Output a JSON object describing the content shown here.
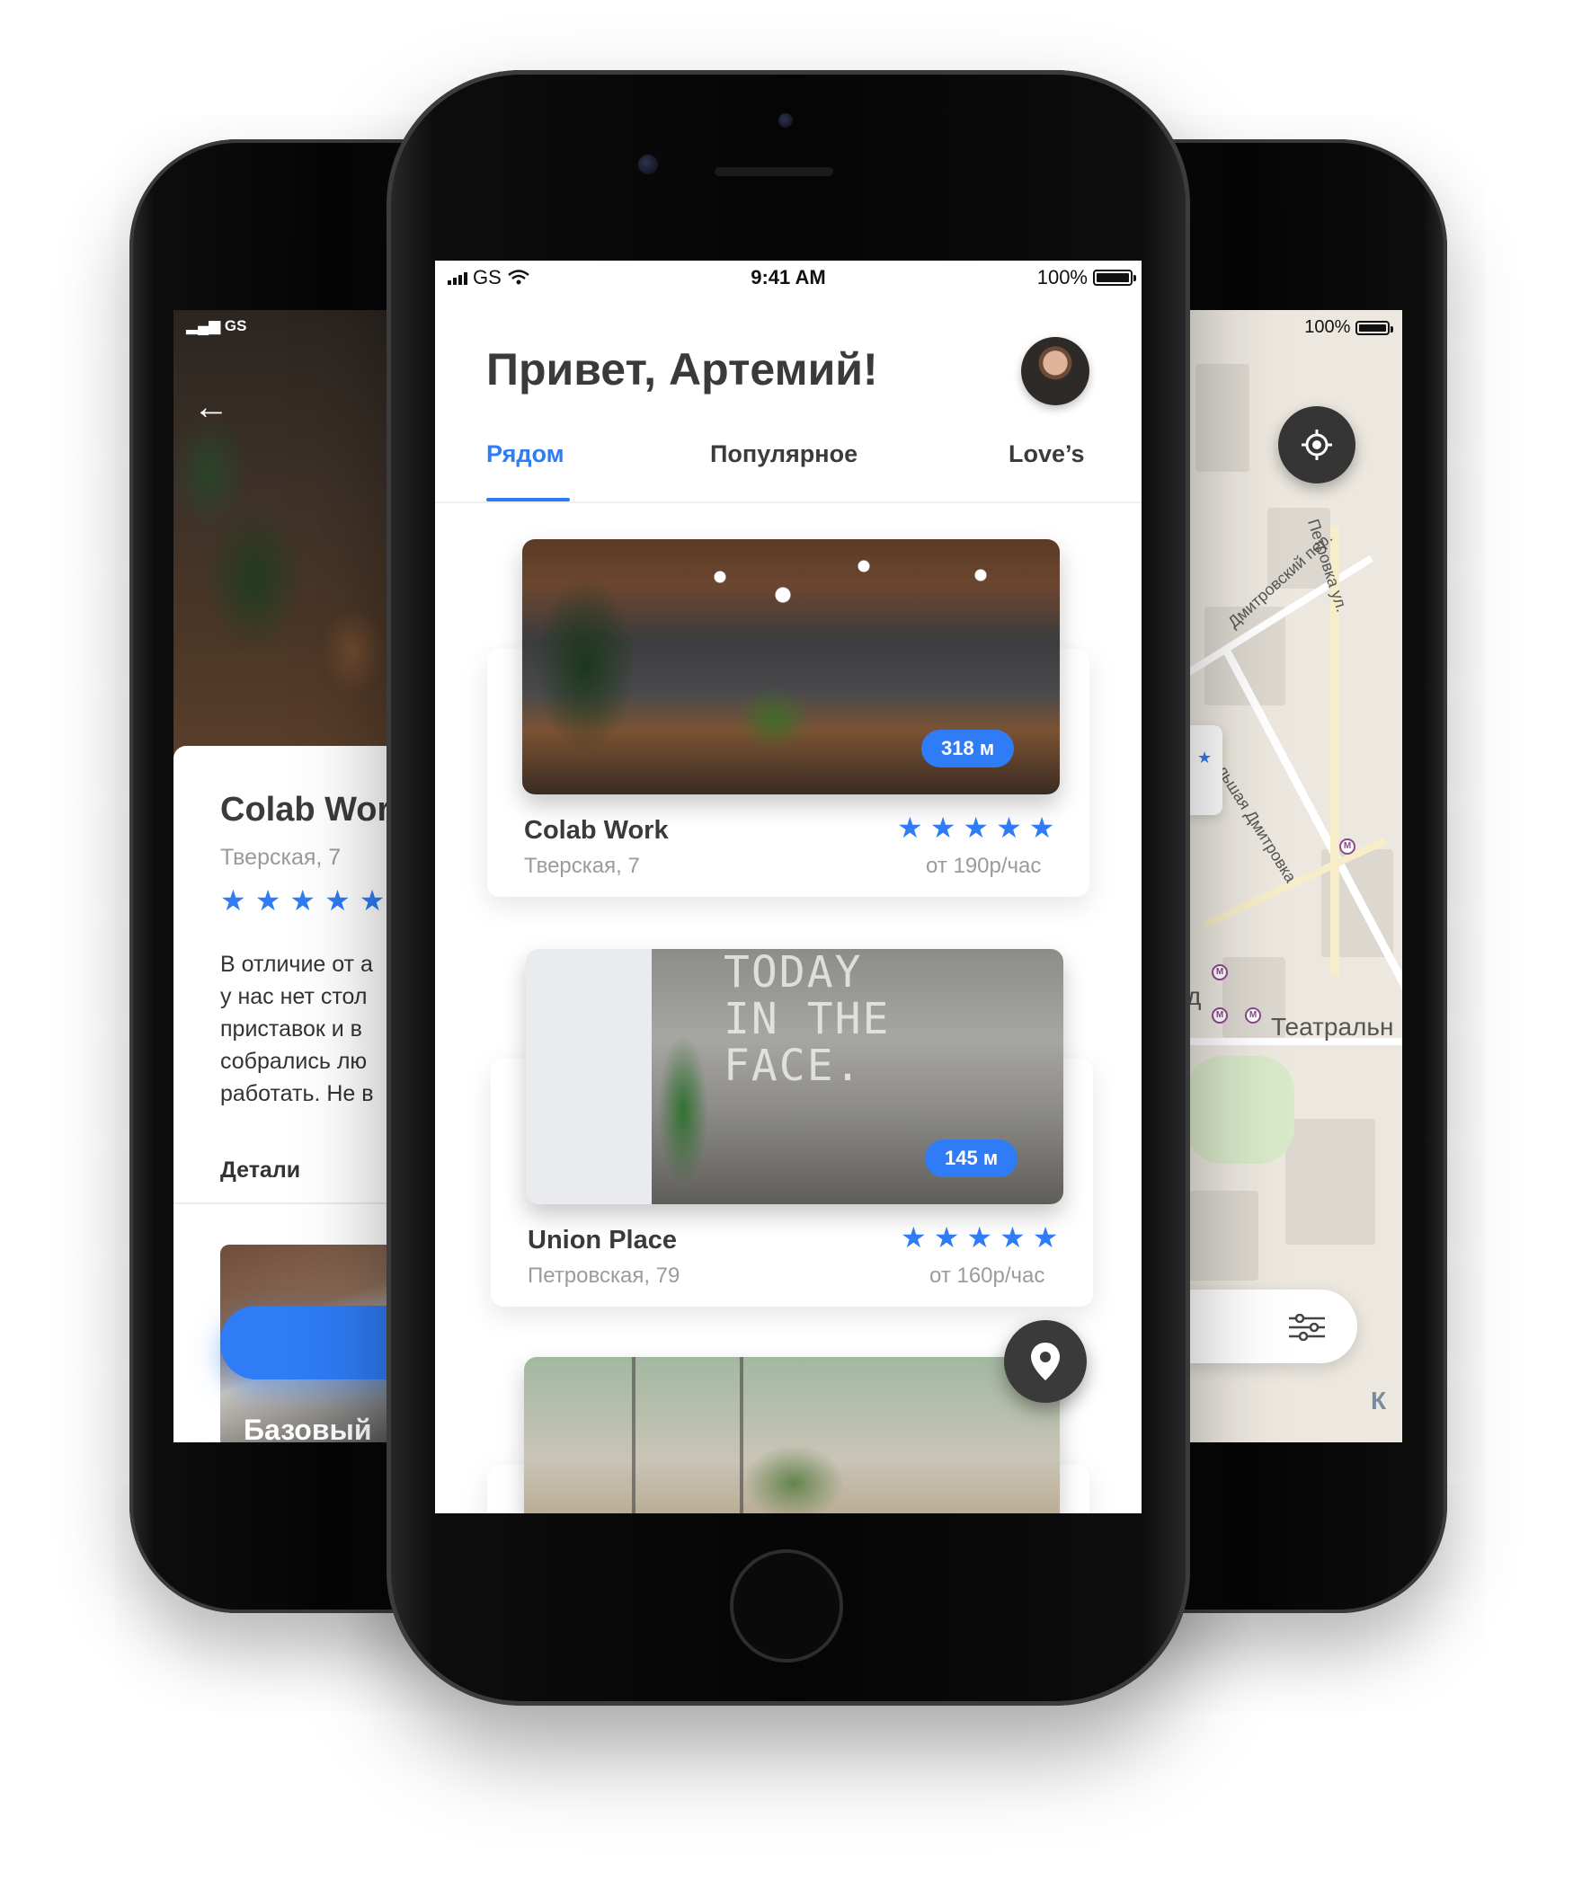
{
  "left_screen": {
    "status": "GS",
    "back_arrow": "←",
    "title": "Colab Work",
    "address": "Тверская, 7",
    "stars": "★★★★★",
    "description_lines": [
      "В отличие от а",
      "у нас нет стол",
      "приставок и в",
      "собрались лю",
      "работать. Не в"
    ],
    "details_label": "Детали",
    "plan_label": "Базовый"
  },
  "center_screen": {
    "status_bar": {
      "carrier": "GS",
      "time": "9:41 AM",
      "battery": "100%"
    },
    "greeting": "Привет, Артемий!",
    "tabs": [
      {
        "label": "Рядом",
        "active": true
      },
      {
        "label": "Популярное",
        "active": false
      },
      {
        "label": "Love’s",
        "active": false
      }
    ],
    "places": [
      {
        "name": "Colab Work",
        "address": "Тверская, 7",
        "distance": "318 м",
        "rating_stars": "★★★★★",
        "price": "от 190р/час"
      },
      {
        "name": "Union Place",
        "address": "Петровская, 79",
        "distance": "145 м",
        "rating_stars": "★★★★★",
        "price": "от 160р/час",
        "image_text": "TODAY\nIN THE\nFACE."
      }
    ],
    "map_pin_icon": "location-pin-icon"
  },
  "right_screen": {
    "battery": "100%",
    "labels": {
      "street_1": "Дмитровский пер.",
      "street_2": "Петровка ул.",
      "street_3": "ул. Большая Дмитровка",
      "station": "Театральн",
      "fragment_left": "д",
      "fragment_bottom": "К"
    },
    "metro_glyph": "М",
    "star": "★"
  },
  "colors": {
    "accent": "#2f7cf6",
    "text_dark": "#3a3a3a",
    "text_muted": "#9b9b9b",
    "fab_dark": "#3a3a3a"
  }
}
